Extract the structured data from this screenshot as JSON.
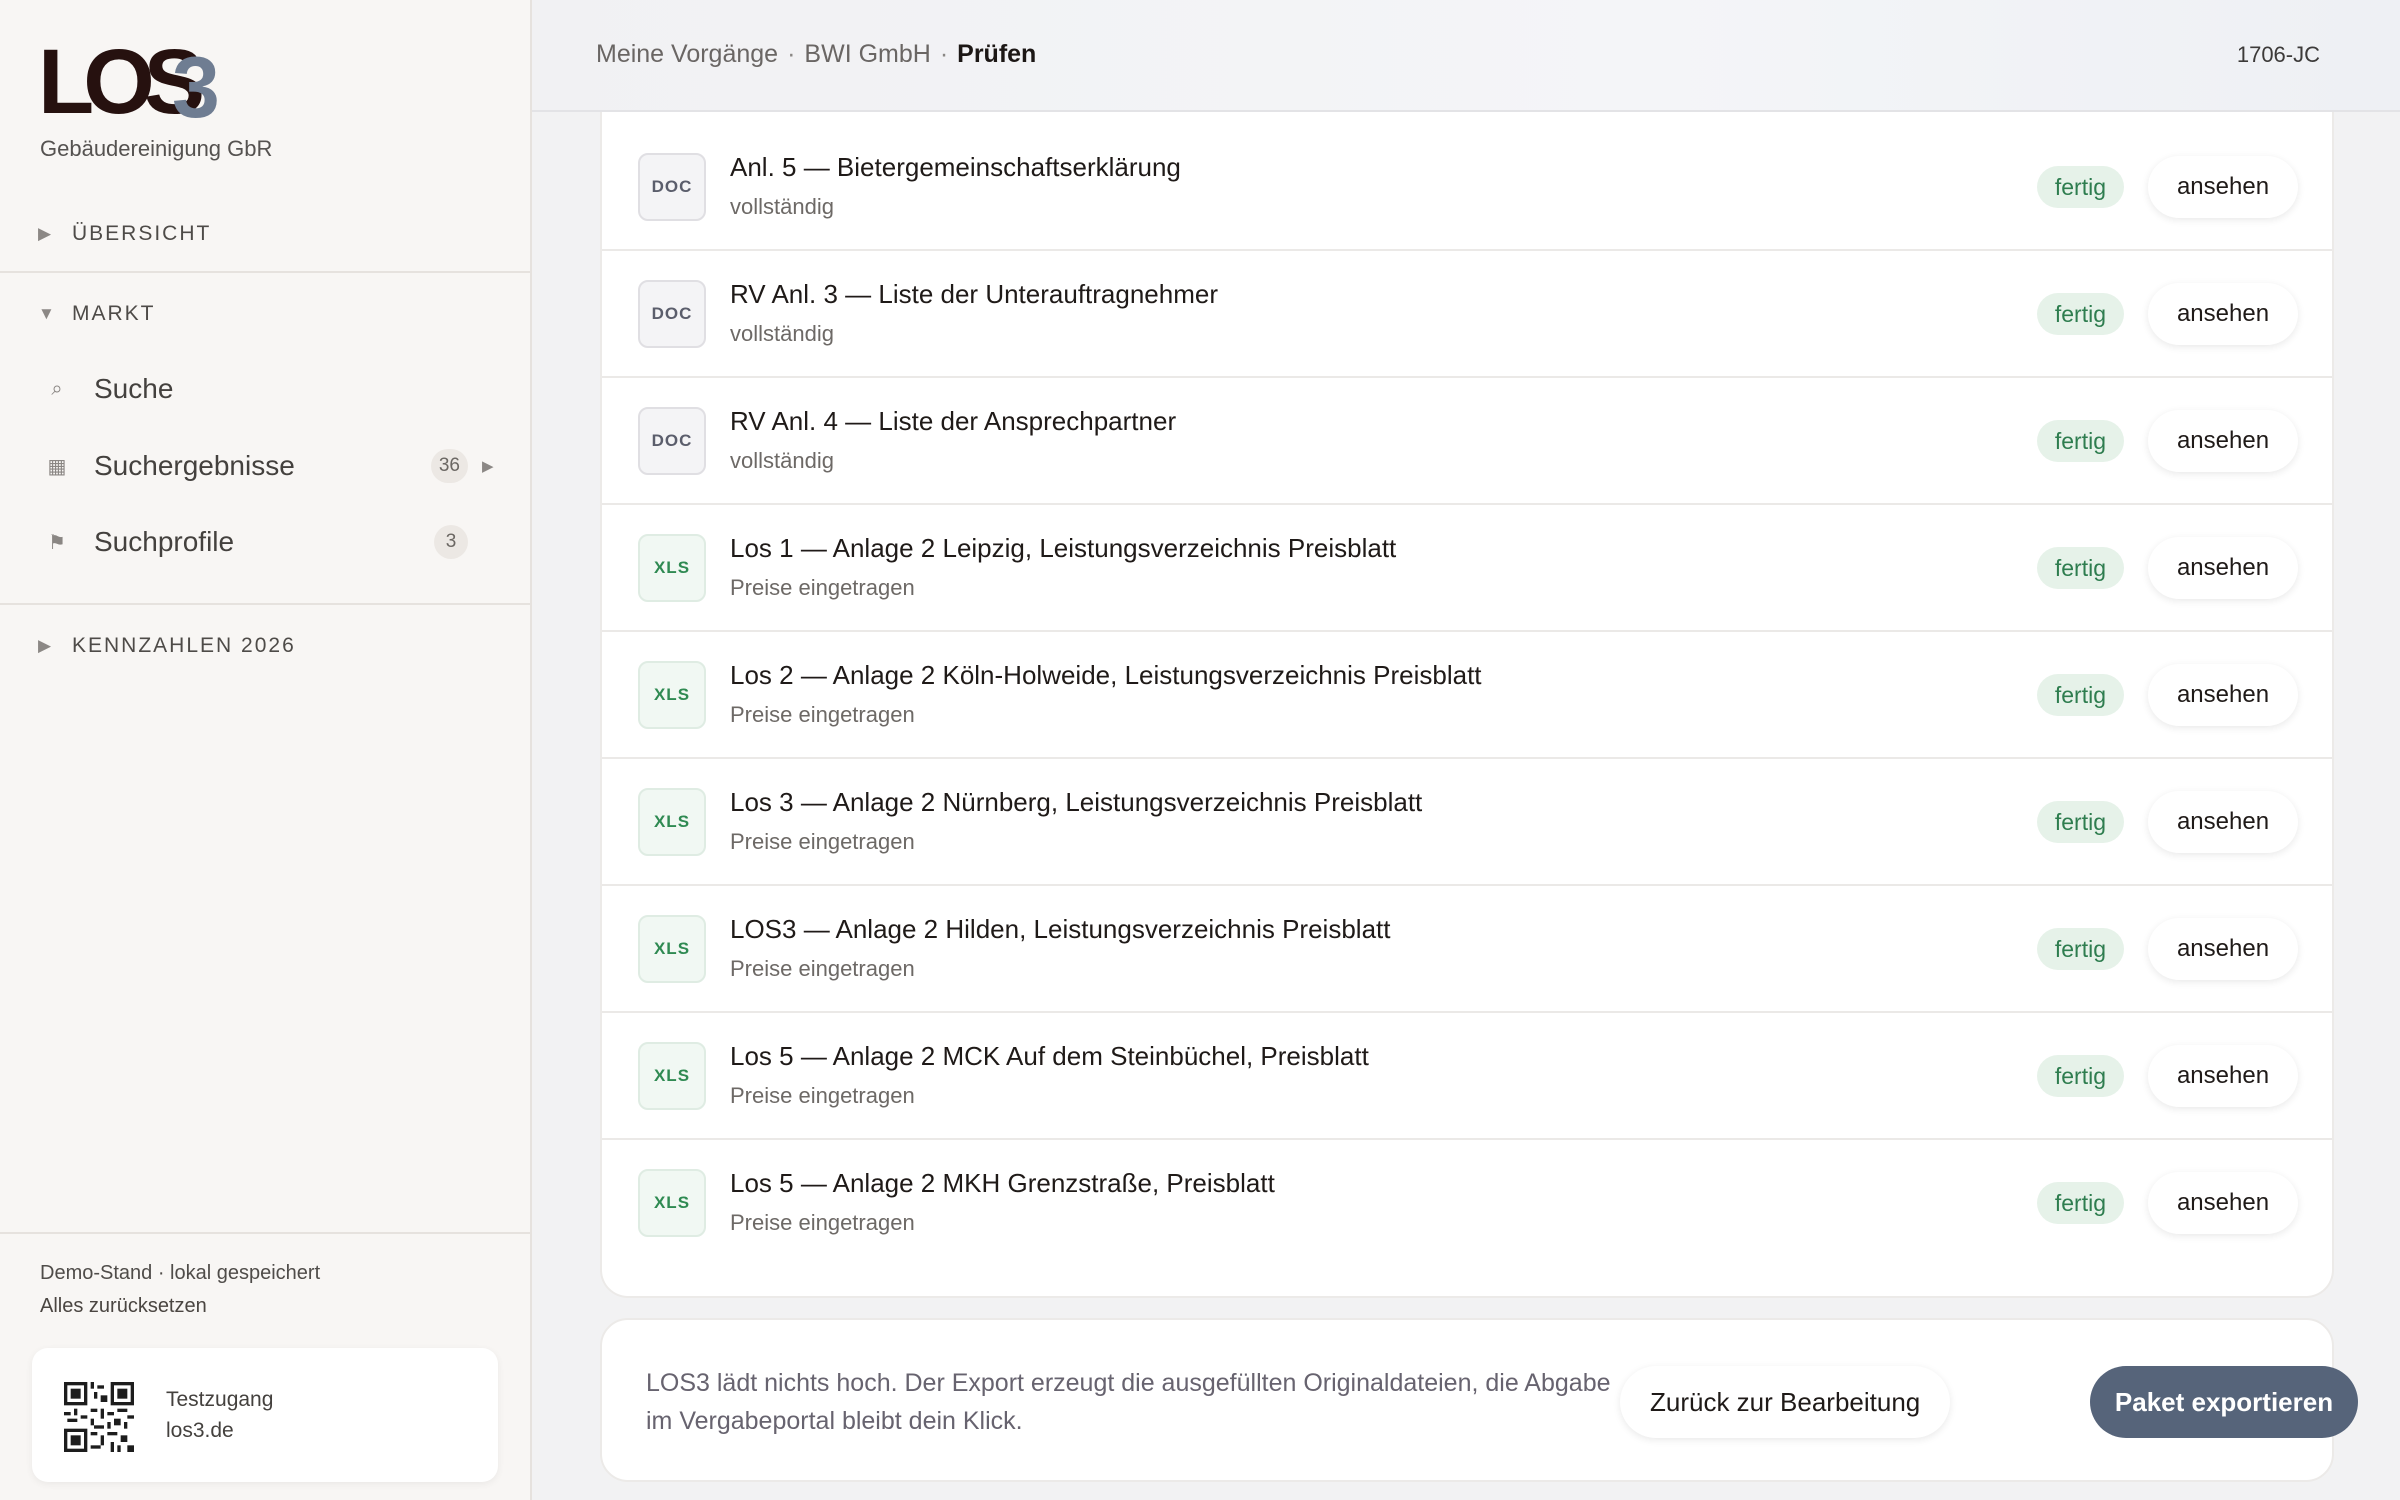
{
  "brand": {
    "logo_main": "LOS",
    "logo_number": "3",
    "company": "Gebäudereinigung GbR"
  },
  "sidebar": {
    "overview": "ÜBERSICHT",
    "market": "MARKT",
    "items": [
      {
        "icon": "search-icon",
        "label": "Suche",
        "count": null
      },
      {
        "icon": "grid-icon",
        "label": "Suchergebnisse",
        "count": "36"
      },
      {
        "icon": "flag-icon",
        "label": "Suchprofile",
        "count": "3"
      }
    ],
    "kpis": "KENNZAHLEN 2026",
    "demo_status": "Demo-Stand · lokal gespeichert",
    "reset": "Alles zurücksetzen",
    "test_title": "Testzugang",
    "test_url": "los3.de"
  },
  "header": {
    "crumb_1": "Meine Vorgänge",
    "crumb_2": "BWI GmbH",
    "crumb_3": "Prüfen",
    "separator": "·",
    "user_code": "1706-JC"
  },
  "documents": [
    {
      "type": "DOC",
      "title": "Anl. 5 — Bietergemeinschaftserklärung",
      "subtitle": "vollständig",
      "status": "fertig",
      "action": "ansehen"
    },
    {
      "type": "DOC",
      "title": "RV Anl. 3 — Liste der Unterauftragnehmer",
      "subtitle": "vollständig",
      "status": "fertig",
      "action": "ansehen"
    },
    {
      "type": "DOC",
      "title": "RV Anl. 4 — Liste der Ansprechpartner",
      "subtitle": "vollständig",
      "status": "fertig",
      "action": "ansehen"
    },
    {
      "type": "XLS",
      "title": "Los 1 — Anlage 2 Leipzig, Leistungsverzeichnis Preisblatt",
      "subtitle": "Preise eingetragen",
      "status": "fertig",
      "action": "ansehen"
    },
    {
      "type": "XLS",
      "title": "Los 2 — Anlage 2 Köln-Holweide, Leistungsverzeichnis Preisblatt",
      "subtitle": "Preise eingetragen",
      "status": "fertig",
      "action": "ansehen"
    },
    {
      "type": "XLS",
      "title": "Los 3 — Anlage 2 Nürnberg, Leistungsverzeichnis Preisblatt",
      "subtitle": "Preise eingetragen",
      "status": "fertig",
      "action": "ansehen"
    },
    {
      "type": "XLS",
      "title": "LOS3 — Anlage 2 Hilden, Leistungsverzeichnis Preisblatt",
      "subtitle": "Preise eingetragen",
      "status": "fertig",
      "action": "ansehen"
    },
    {
      "type": "XLS",
      "title": "Los 5 — Anlage 2 MCK Auf dem Steinbüchel, Preisblatt",
      "subtitle": "Preise eingetragen",
      "status": "fertig",
      "action": "ansehen"
    },
    {
      "type": "XLS",
      "title": "Los 5 — Anlage 2 MKH Grenzstraße, Preisblatt",
      "subtitle": "Preise eingetragen",
      "status": "fertig",
      "action": "ansehen"
    }
  ],
  "export": {
    "notice": "LOS3 lädt nichts hoch. Der Export erzeugt die ausgefüllten Originaldateien, die Abgabe im Vergabeportal bleibt dein Klick.",
    "back_label": "Zurück zur Bearbeitung",
    "export_label": "Paket exportieren"
  },
  "colors": {
    "accent": "#56647a",
    "status_green": "#2e7d4f",
    "logo_dark": "#26110f",
    "logo_gray": "#6f7d92"
  }
}
